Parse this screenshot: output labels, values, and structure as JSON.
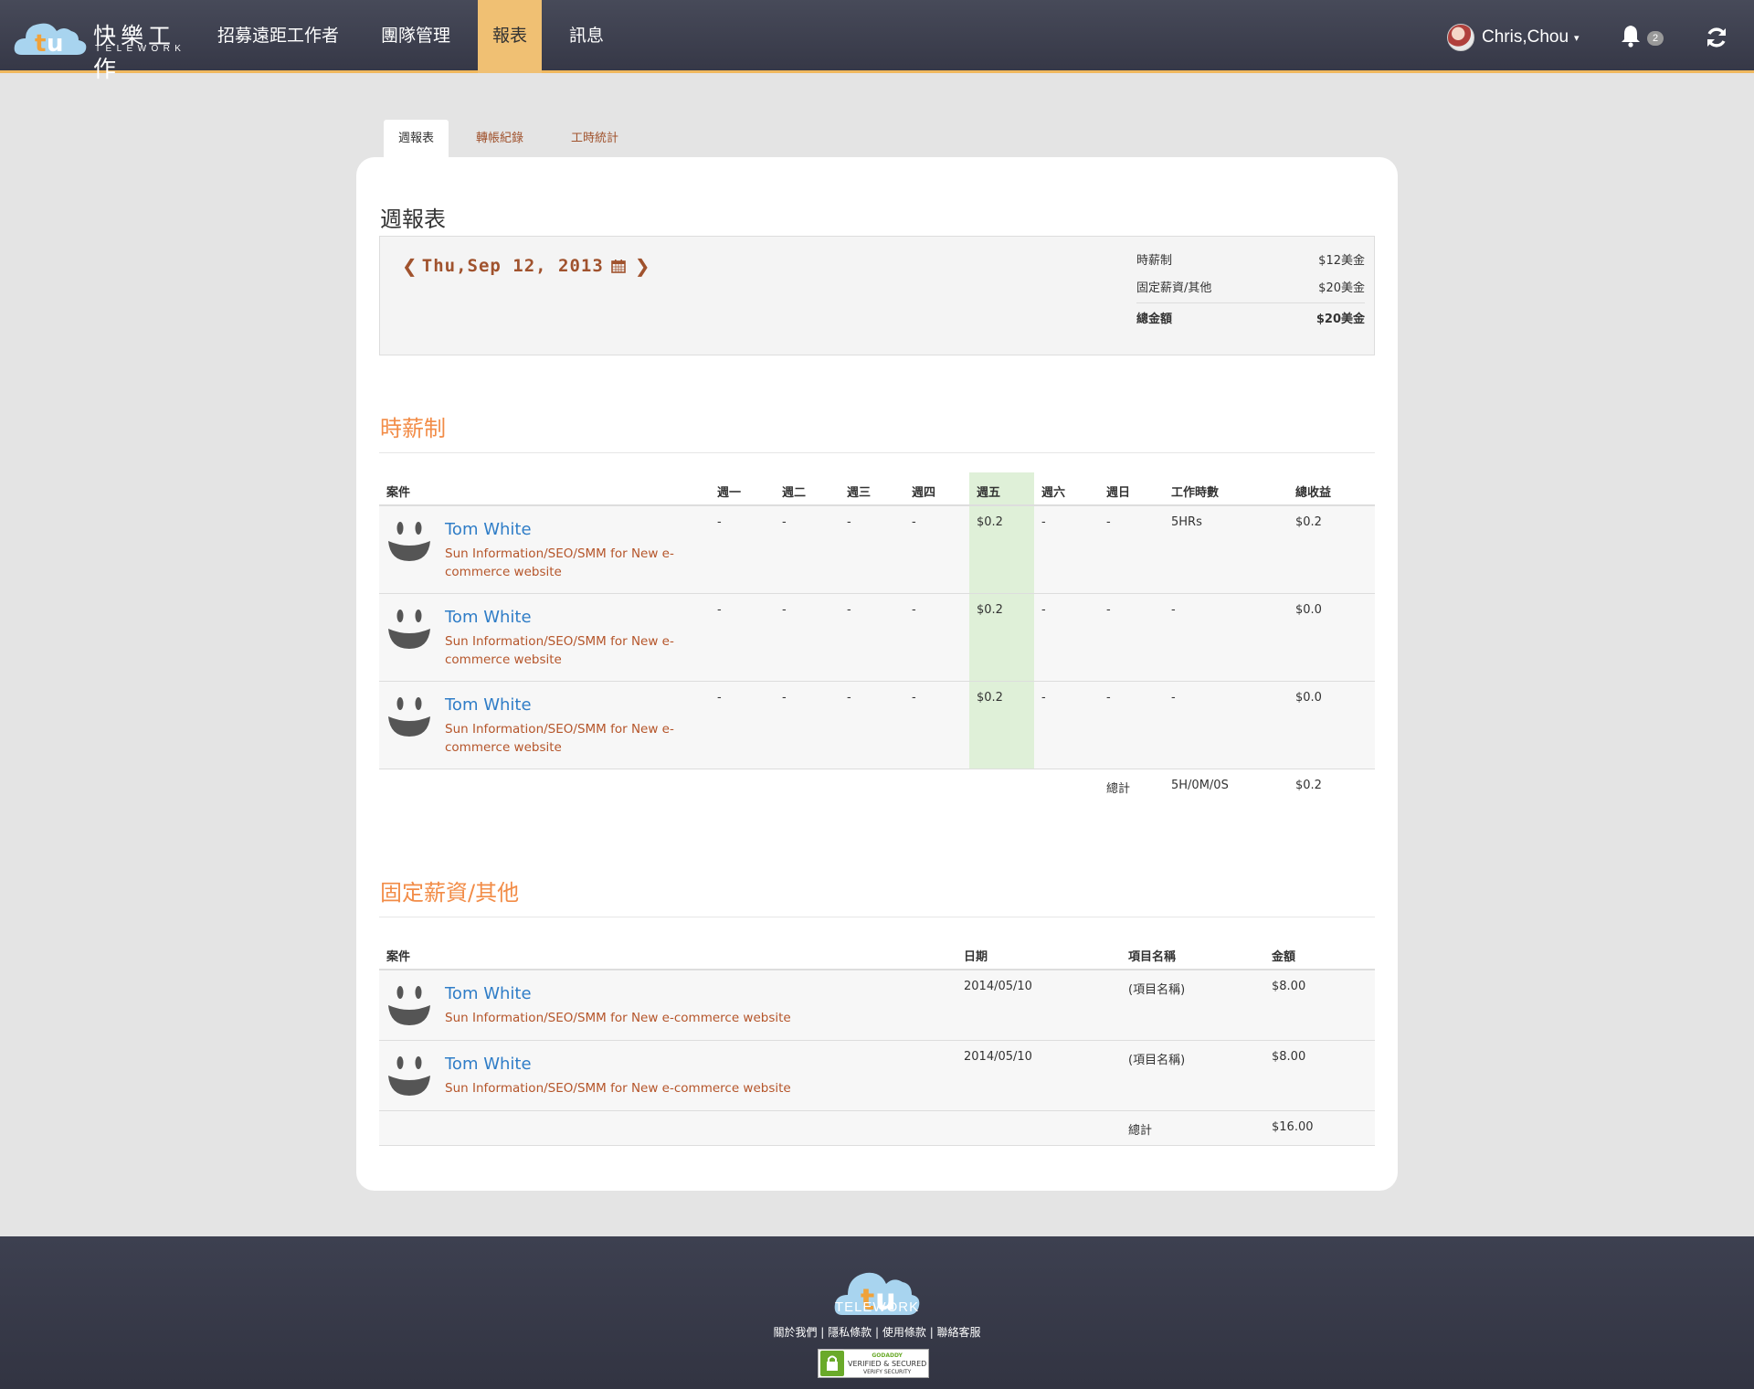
{
  "header": {
    "logo_cn": "快樂工作",
    "logo_en": "TELEWORK",
    "nav": [
      "招募遠距工作者",
      "團隊管理",
      "報表",
      "訊息"
    ],
    "active_nav": "報表",
    "user_name": "Chris,Chou",
    "notification_count": "2",
    "accent_color": "#f0c073"
  },
  "tabs": [
    "週報表",
    "轉帳紀錄",
    "工時統計"
  ],
  "page_title": "週報表",
  "date_label": "Thu,Sep 12, 2013",
  "summary": {
    "rows": [
      {
        "label": "時薪制",
        "value": "$12美金"
      },
      {
        "label": "固定薪資/其他",
        "value": "$20美金"
      }
    ],
    "total_label": "總金額",
    "total_value": "$20美金"
  },
  "hourly": {
    "title": "時薪制",
    "headers": [
      "案件",
      "週一",
      "週二",
      "週三",
      "週四",
      "週五",
      "週六",
      "週日",
      "工作時數",
      "總收益"
    ],
    "rows": [
      {
        "name": "Tom White",
        "desc": "Sun Information/SEO/SMM for New e-commerce website",
        "mon": "-",
        "tue": "-",
        "wed": "-",
        "thu": "-",
        "fri": "$0.2",
        "sat": "-",
        "sun": "-",
        "hours": "5HRs",
        "total": "$0.2"
      },
      {
        "name": "Tom White",
        "desc": "Sun Information/SEO/SMM for New e-commerce website",
        "mon": "-",
        "tue": "-",
        "wed": "-",
        "thu": "-",
        "fri": "$0.2",
        "sat": "-",
        "sun": "-",
        "hours": "-",
        "total": "$0.0"
      },
      {
        "name": "Tom White",
        "desc": "Sun Information/SEO/SMM for New e-commerce website",
        "mon": "-",
        "tue": "-",
        "wed": "-",
        "thu": "-",
        "fri": "$0.2",
        "sat": "-",
        "sun": "-",
        "hours": "-",
        "total": "$0.0"
      }
    ],
    "footer": {
      "label": "總計",
      "hours": "5H/0M/0S",
      "total": "$0.2"
    }
  },
  "fixed": {
    "title": "固定薪資/其他",
    "headers": [
      "案件",
      "日期",
      "項目名稱",
      "金額"
    ],
    "rows": [
      {
        "name": "Tom White",
        "desc": "Sun Information/SEO/SMM for New e-commerce website",
        "date": "2014/05/10",
        "item": "(項目名稱)",
        "amount": "$8.00"
      },
      {
        "name": "Tom White",
        "desc": "Sun Information/SEO/SMM for New e-commerce website",
        "date": "2014/05/10",
        "item": "(項目名稱)",
        "amount": "$8.00"
      }
    ],
    "footer": {
      "label": "總計",
      "total": "$16.00"
    }
  },
  "footer": {
    "logo_text": "TELEWORK",
    "links": [
      "關於我們",
      "隱私條款",
      "使用條款",
      "聯絡客服"
    ],
    "seal_brand": "GODADDY",
    "seal_line1": "VERIFIED & SECURED",
    "seal_line2": "VERIFY SECURITY"
  }
}
